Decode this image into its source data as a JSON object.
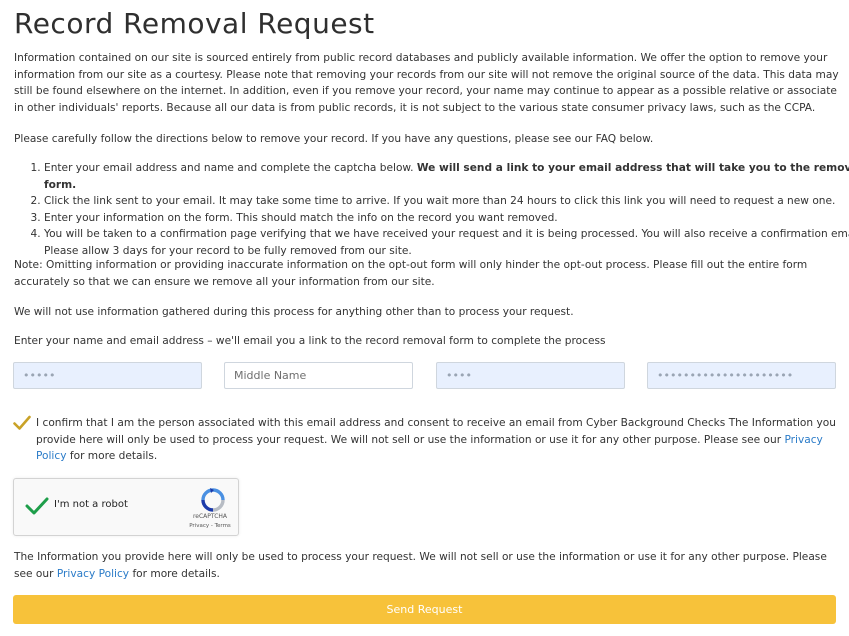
{
  "page": {
    "title": "Record Removal Request",
    "intro": "Information contained on our site is sourced entirely from public record databases and publicly available information. We offer the option to remove your information from our site as a courtesy. Please note that removing your records from our site will not remove the original source of the data. This data may still be found elsewhere on the internet. In addition, even if you remove your record, your name may continue to appear as a possible relative or associate in other individuals' reports. Because all our data is from public records, it is not subject to the various state consumer privacy laws, such as the CCPA.",
    "directions": "Please carefully follow the directions below to remove your record. If you have any questions, please see our FAQ below.",
    "steps": {
      "step1_text": "Enter your email address and name and complete the captcha below.",
      "step1_bold": "We will send a link to your email address that will take you to the removal form.",
      "step2": "Click the link sent to your email. It may take some time to arrive. If you wait more than 24 hours to click this link you will need to request a new one.",
      "step3": "Enter your information on the form. This should match the info on the record you want removed.",
      "step4": "You will be taken to a confirmation page verifying that we have received your request and it is being processed. You will also receive a confirmation email. Please allow 3 days for your record to be fully removed from our site."
    },
    "note": "Note: Omitting information or providing inaccurate information on the opt-out form will only hinder the opt-out process. Please fill out the entire form accurately so that we can ensure we remove all your information from our site.",
    "usage": "We will not use information gathered during this process for anything other than to process your request.",
    "form_prompt": "Enter your name and email address – we'll email you a link to the record removal form to complete the process"
  },
  "form": {
    "first_name_value": "•••••",
    "middle_name_placeholder": "Middle Name",
    "last_name_value": "••••",
    "email_value": "•••••••••••••••••••••"
  },
  "consent": {
    "text": "I confirm that I am the person associated with this email address and consent to receive an email from Cyber Background Checks The Information you provide here will only be used to process your request. We will not sell or use the information or use it for any other purpose. Please see our",
    "link": "Privacy Policy",
    "suffix": "for more details."
  },
  "captcha": {
    "label": "I'm not a robot",
    "brand": "reCAPTCHA",
    "terms": "Privacy - Terms"
  },
  "footer": {
    "text": "The Information you provide here will only be used to process your request. We will not sell or use the information or use it for any other purpose. Please see our",
    "link": "Privacy Policy",
    "suffix": "for more details."
  },
  "submit": {
    "label": "Send Request"
  },
  "colors": {
    "accent_button": "#f7c23a",
    "link": "#2a7bc8",
    "autofill_bg": "#e8f0fe",
    "check_gold": "#c9a227",
    "captcha_check_green": "#1e9e4a"
  },
  "icons": {
    "consent_checkbox": "checkmark-icon",
    "captcha_check": "check-icon",
    "captcha_logo": "recaptcha-logo-icon"
  }
}
